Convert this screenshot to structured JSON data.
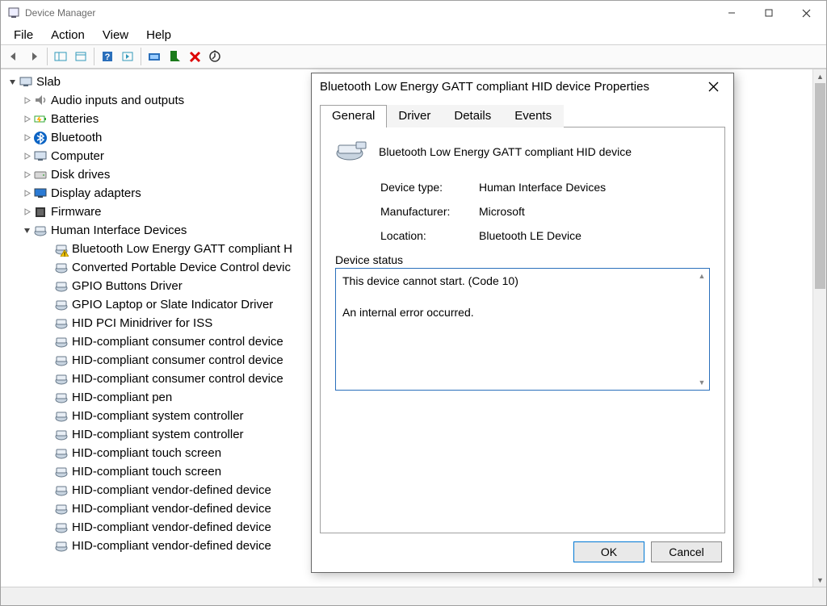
{
  "window": {
    "title": "Device Manager"
  },
  "menubar": [
    "File",
    "Action",
    "View",
    "Help"
  ],
  "tree": {
    "root": "Slab",
    "categories": [
      {
        "label": "Audio inputs and outputs",
        "expanded": false,
        "icon": "audio"
      },
      {
        "label": "Batteries",
        "expanded": false,
        "icon": "battery"
      },
      {
        "label": "Bluetooth",
        "expanded": false,
        "icon": "bluetooth"
      },
      {
        "label": "Computer",
        "expanded": false,
        "icon": "computer"
      },
      {
        "label": "Disk drives",
        "expanded": false,
        "icon": "disk"
      },
      {
        "label": "Display adapters",
        "expanded": false,
        "icon": "display"
      },
      {
        "label": "Firmware",
        "expanded": false,
        "icon": "firmware"
      },
      {
        "label": "Human Interface Devices",
        "expanded": true,
        "icon": "hid",
        "children": [
          {
            "label": "Bluetooth Low Energy GATT compliant H",
            "warn": true
          },
          {
            "label": "Converted Portable Device Control devic"
          },
          {
            "label": "GPIO Buttons Driver"
          },
          {
            "label": "GPIO Laptop or Slate Indicator Driver"
          },
          {
            "label": "HID PCI Minidriver for ISS"
          },
          {
            "label": "HID-compliant consumer control device"
          },
          {
            "label": "HID-compliant consumer control device"
          },
          {
            "label": "HID-compliant consumer control device"
          },
          {
            "label": "HID-compliant pen"
          },
          {
            "label": "HID-compliant system controller"
          },
          {
            "label": "HID-compliant system controller"
          },
          {
            "label": "HID-compliant touch screen"
          },
          {
            "label": "HID-compliant touch screen"
          },
          {
            "label": "HID-compliant vendor-defined device"
          },
          {
            "label": "HID-compliant vendor-defined device"
          },
          {
            "label": "HID-compliant vendor-defined device"
          },
          {
            "label": "HID-compliant vendor-defined device"
          }
        ]
      }
    ]
  },
  "dialog": {
    "title": "Bluetooth Low Energy GATT compliant HID device Properties",
    "tabs": [
      "General",
      "Driver",
      "Details",
      "Events"
    ],
    "active_tab": 0,
    "device_name": "Bluetooth Low Energy GATT compliant HID device",
    "rows": {
      "device_type": {
        "label": "Device type:",
        "value": "Human Interface Devices"
      },
      "manufacturer": {
        "label": "Manufacturer:",
        "value": "Microsoft"
      },
      "location": {
        "label": "Location:",
        "value": "Bluetooth LE Device"
      }
    },
    "status_label": "Device status",
    "status_line1": "This device cannot start. (Code 10)",
    "status_line2": "An internal error occurred.",
    "ok": "OK",
    "cancel": "Cancel"
  }
}
